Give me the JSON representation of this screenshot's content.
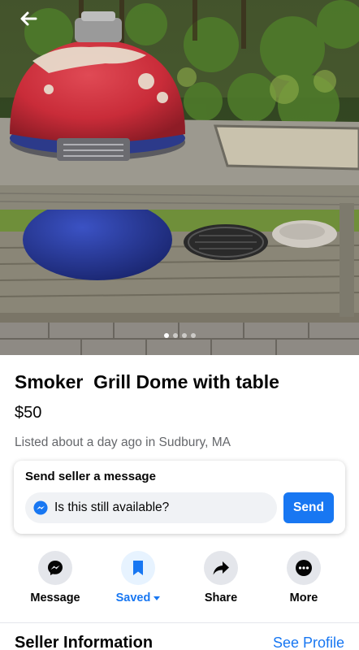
{
  "photo": {
    "alt_icon": "arrow-left-icon",
    "carousel": {
      "count": 4,
      "active_index": 0
    }
  },
  "listing": {
    "title": "Smoker  Grill Dome with table",
    "price": "$50",
    "meta": "Listed about a day ago in Sudbury, MA"
  },
  "message_card": {
    "heading": "Send seller a message",
    "input_value": "Is this still available?",
    "send_label": "Send",
    "icon": "messenger-icon"
  },
  "actions": [
    {
      "label": "Message",
      "icon": "messenger-icon"
    },
    {
      "label": "Saved",
      "icon": "bookmark-icon",
      "active": true
    },
    {
      "label": "Share",
      "icon": "share-arrow-icon"
    },
    {
      "label": "More",
      "icon": "more-dots-icon"
    }
  ],
  "seller": {
    "heading": "Seller Information",
    "see_profile": "See Profile"
  },
  "colors": {
    "accent": "#1877f2",
    "text_primary": "#050505",
    "text_secondary": "#65676b",
    "button_bg": "#e4e6eb"
  }
}
